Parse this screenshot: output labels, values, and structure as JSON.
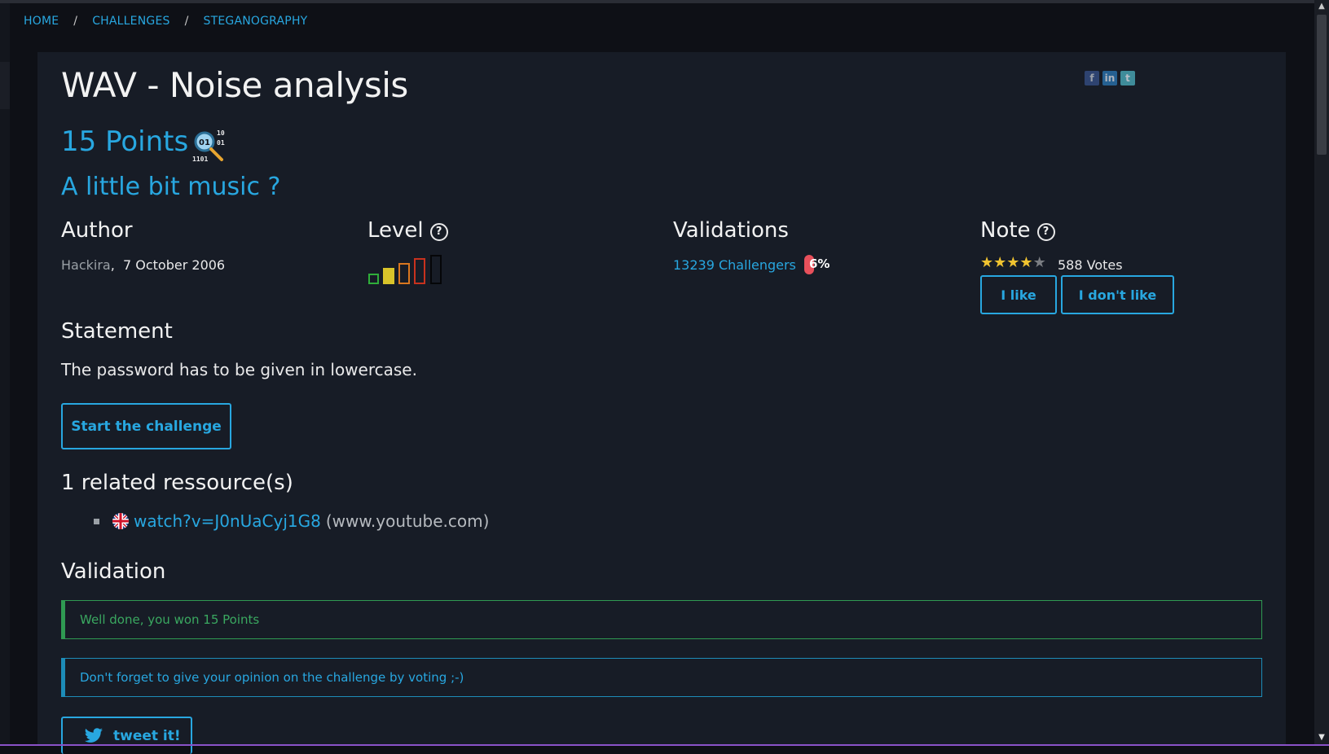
{
  "breadcrumb": {
    "home": "HOME",
    "challenges": "CHALLENGES",
    "category": "STEGANOGRAPHY",
    "separator": "/"
  },
  "challenge": {
    "title": "WAV - Noise analysis",
    "points": "15 Points",
    "subtitle": "A little bit music ?"
  },
  "social": {
    "facebook": "f",
    "linkedin": "in",
    "twitter": "t"
  },
  "author": {
    "heading": "Author",
    "name": "Hackira",
    "separator": ",",
    "date": "7 October 2006"
  },
  "level": {
    "heading": "Level",
    "help": "?",
    "current": 2,
    "max": 5
  },
  "validations": {
    "heading": "Validations",
    "challengers": "13239 Challengers",
    "percent": "6%"
  },
  "note": {
    "heading": "Note",
    "help": "?",
    "rating": 4,
    "max": 5,
    "votes": "588 Votes",
    "like_label": "I like",
    "dislike_label": "I don't like"
  },
  "statement": {
    "heading": "Statement",
    "text": "The password has to be given in lowercase."
  },
  "start_button": "Start the challenge",
  "resources": {
    "heading": "1 related ressource(s)",
    "items": [
      {
        "link": "watch?v=J0nUaCyj1G8",
        "host": "(www.youtube.com)"
      }
    ]
  },
  "validation": {
    "heading": "Validation",
    "success": "Well done, you won 15 Points",
    "info": "Don't forget to give your opinion on the challenge by voting ;-)",
    "tweet_label": "tweet it!"
  },
  "colors": {
    "accent": "#28a7e0",
    "success": "#2f9a52",
    "panel": "#171c26",
    "background": "#0e1016",
    "star": "#f0c330",
    "percent_pill": "#e8505b"
  },
  "icons": {
    "category": "steganography-magnifier-icon",
    "flag": "uk-flag-icon",
    "tweet": "twitter-bird-icon"
  }
}
